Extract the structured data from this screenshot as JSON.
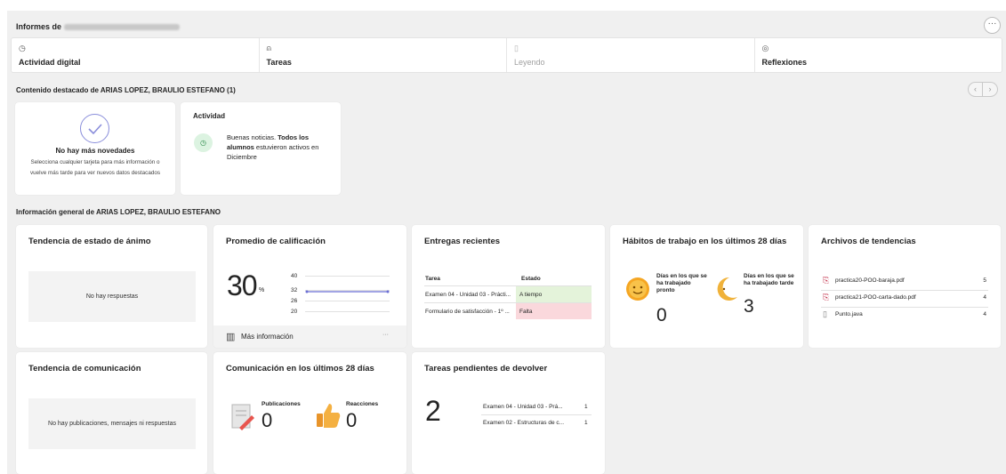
{
  "header": {
    "title_prefix": "Informes de",
    "more_label": "···"
  },
  "tabs": [
    {
      "icon": "◷",
      "label": "Actividad digital"
    },
    {
      "icon": "⍝",
      "label": "Tareas"
    },
    {
      "icon": "▯",
      "label": "Leyendo"
    },
    {
      "icon": "◎",
      "label": "Reflexiones"
    }
  ],
  "featured": {
    "title": "Contenido destacado de ARIAS LOPEZ, BRAULIO ESTEFANO (1)",
    "arrow_prev": "‹",
    "arrow_next": "›",
    "no_news": {
      "title": "No hay más novedades",
      "desc": "Selecciona cualquier tarjeta para más información o vuelve más tarde para ver nuevos datos destacados"
    },
    "activity": {
      "title": "Actividad",
      "text_pre": "Buenas noticias. ",
      "text_bold": "Todos los alumnos",
      "text_post": " estuvieron activos en Diciembre"
    }
  },
  "overview": {
    "title": "Información general de ARIAS LOPEZ, BRAULIO ESTEFANO"
  },
  "cards": {
    "mood": {
      "title": "Tendencia de estado de ánimo",
      "empty": "No hay respuestas"
    },
    "grade": {
      "title": "Promedio de calificación",
      "value": "30",
      "unit": "%",
      "ticks": [
        "40",
        "32",
        "26",
        "20"
      ],
      "more_label": "Más información",
      "ellipsis": "···"
    },
    "submissions": {
      "title": "Entregas recientes",
      "col_task": "Tarea",
      "col_state": "Estado",
      "rows": [
        {
          "task": "Examen 04 - Unidad 03 - Prácti...",
          "state": "A tiempo",
          "ok": true
        },
        {
          "task": "Formulario de satisfacción - 1º ...",
          "state": "Falta",
          "ok": false
        }
      ]
    },
    "habits": {
      "title": "Hábitos de trabajo en los últimos 28 días",
      "early_label": "Días en los que se ha trabajado pronto",
      "early_value": "0",
      "late_label": "Días en los que se ha trabajado tarde",
      "late_value": "3"
    },
    "files": {
      "title": "Archivos de tendencias",
      "rows": [
        {
          "name": "practica20-POO-baraja.pdf",
          "count": "5",
          "icon": "pdf"
        },
        {
          "name": "practica21-POO-carta-dado.pdf",
          "count": "4",
          "icon": "pdf"
        },
        {
          "name": "Punto.java",
          "count": "4",
          "icon": "doc"
        }
      ]
    },
    "comm_trend": {
      "title": "Tendencia de comunicación",
      "empty": "No hay publicaciones, mensajes ni respuestas"
    },
    "comm28": {
      "title": "Comunicación en los últimos 28 días",
      "posts_label": "Publicaciones",
      "posts_value": "0",
      "reactions_label": "Reacciones",
      "reactions_value": "0"
    },
    "pending": {
      "title": "Tareas pendientes de devolver",
      "value": "2",
      "rows": [
        {
          "name": "Examen 04 - Unidad 03 - Prá...",
          "count": "1"
        },
        {
          "name": "Examen 02 - Estructuras de c...",
          "count": "1"
        }
      ]
    }
  },
  "colors": {
    "accent": "#6b6fd4",
    "ok": "#e4f3da",
    "bad": "#fad8dc"
  }
}
